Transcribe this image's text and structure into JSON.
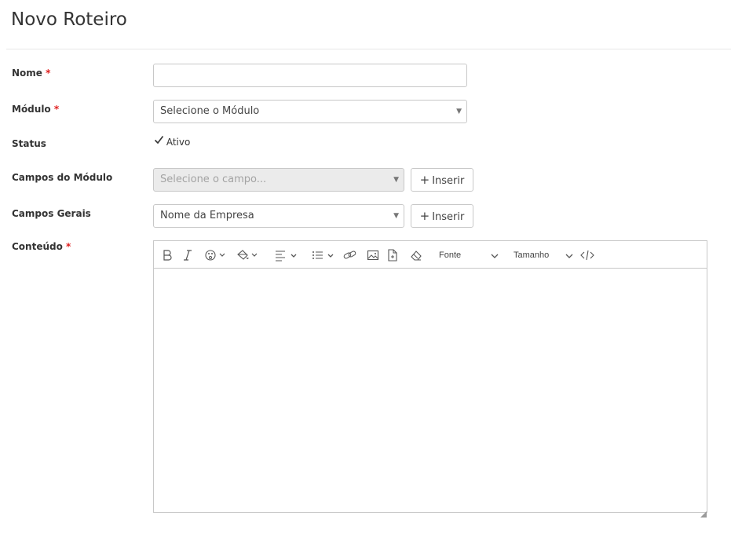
{
  "page": {
    "title": "Novo Roteiro"
  },
  "form": {
    "required_mark": "*",
    "nome": {
      "label": "Nome",
      "value": ""
    },
    "modulo": {
      "label": "Módulo",
      "selected": "Selecione o Módulo"
    },
    "status": {
      "label": "Status",
      "checkbox_label": "Ativo",
      "checked": true
    },
    "campos_modulo": {
      "label": "Campos do Módulo",
      "placeholder": "Selecione o campo...",
      "button_label": "Inserir",
      "disabled": true
    },
    "campos_gerais": {
      "label": "Campos Gerais",
      "selected": "Nome da Empresa",
      "button_label": "Inserir"
    },
    "conteudo": {
      "label": "Conteúdo",
      "toolbar": {
        "font_label": "Fonte",
        "size_label": "Tamanho",
        "icons": [
          "bold-icon",
          "italic-icon",
          "text-color-icon",
          "background-color-icon",
          "align-icon",
          "list-icon",
          "link-icon",
          "image-icon",
          "file-icon",
          "eraser-icon",
          "code-icon"
        ]
      },
      "value": ""
    }
  },
  "colors": {
    "required": "#e01e1e",
    "border": "#c8c8c8",
    "disabled_bg": "#ebebeb"
  }
}
